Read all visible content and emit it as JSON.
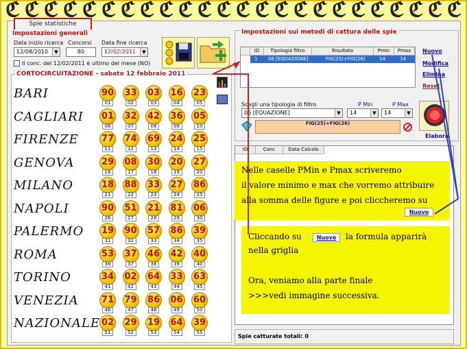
{
  "tab_label": "Spie statistiche",
  "general": {
    "title": "Impostazioni generali",
    "start_label": "Data inizio ricerca",
    "start_value": "12/08/2010",
    "draws_label": "Concorsi",
    "draws_value": "80",
    "end_label": "Data fine ricerca",
    "end_value": "12/02/2011",
    "checkbox_label": "Il conc. del 12/02/2011 è ultimo del mese (NO)"
  },
  "lottery": {
    "title": "CORTOCIRCUITAZIONE - sabato 12 febbraio 2011",
    "rows": [
      {
        "city": "BARI",
        "balls": [
          "90",
          "33",
          "03",
          "16",
          "23"
        ],
        "idx": [
          "01",
          "02",
          "03",
          "04",
          "05"
        ]
      },
      {
        "city": "CAGLIARI",
        "balls": [
          "01",
          "32",
          "42",
          "36",
          "05"
        ],
        "idx": [
          "06",
          "07",
          "08",
          "09",
          "10"
        ]
      },
      {
        "city": "FIRENZE",
        "balls": [
          "77",
          "74",
          "69",
          "24",
          "25"
        ],
        "idx": [
          "11",
          "12",
          "13",
          "14",
          "15"
        ]
      },
      {
        "city": "GENOVA",
        "balls": [
          "29",
          "08",
          "30",
          "20",
          "27"
        ],
        "idx": [
          "16",
          "17",
          "18",
          "19",
          "20"
        ]
      },
      {
        "city": "MILANO",
        "balls": [
          "18",
          "88",
          "33",
          "27",
          "86"
        ],
        "idx": [
          "21",
          "22",
          "23",
          "24",
          "25"
        ]
      },
      {
        "city": "NAPOLI",
        "balls": [
          "90",
          "51",
          "21",
          "81",
          "06"
        ],
        "idx": [
          "26",
          "27",
          "28",
          "29",
          "30"
        ]
      },
      {
        "city": "PALERMO",
        "balls": [
          "19",
          "90",
          "57",
          "86",
          "39"
        ],
        "idx": [
          "31",
          "32",
          "33",
          "34",
          "35"
        ]
      },
      {
        "city": "ROMA",
        "balls": [
          "53",
          "37",
          "46",
          "42",
          "40"
        ],
        "idx": [
          "36",
          "37",
          "38",
          "39",
          "40"
        ]
      },
      {
        "city": "TORINO",
        "balls": [
          "34",
          "02",
          "64",
          "33",
          "63"
        ],
        "idx": [
          "41",
          "42",
          "43",
          "44",
          "45"
        ]
      },
      {
        "city": "VENEZIA",
        "balls": [
          "71",
          "79",
          "86",
          "06",
          "60"
        ],
        "idx": [
          "46",
          "47",
          "48",
          "49",
          "50"
        ]
      },
      {
        "city": "NAZIONALE",
        "balls": [
          "02",
          "29",
          "19",
          "64",
          "39"
        ],
        "idx": [
          "51",
          "52",
          "53",
          "54",
          "55"
        ]
      }
    ]
  },
  "methods": {
    "title": "Impostazioni sui metodi di cattura delle spie",
    "headers": [
      "ID",
      "Tipologia filtro",
      "Risultato",
      "Pmin",
      "Pmax"
    ],
    "row": {
      "id": "1",
      "type": "06 [EQUAZIONE]",
      "result": "FIG(25)+FIG(26)",
      "pmin": "14",
      "pmax": "14"
    },
    "links": {
      "new": "Nuovo",
      "edit": "Modifica",
      "delete": "Elimina",
      "reset": "Reset"
    },
    "filter_label": "Scegli una tipologia di filtro",
    "filter_value": "06 [EQUAZIONE]",
    "pmin_label": "P Min",
    "pmin_value": "14",
    "pmax_label": "P Max",
    "pmax_value": "14",
    "formula": "FIG(25)+FIG(26)",
    "elabora": "Elabora"
  },
  "results": {
    "headers": [
      "ID",
      "Conc",
      "Data Calcolo"
    ],
    "status": "Spie catturate totali: 0"
  },
  "notes": {
    "n1_l1": "Nelle caselle PMin e Pmax scriveremo",
    "n1_l2": "il valore minimo e max che vorremo attribuire",
    "n1_l3": "alla somma delle figure e poi cliccheremo su",
    "n1_btn": "Nuovo",
    "n2_a": "Cliccando su",
    "n2_btn": "Nuovo",
    "n2_b": "la formula apparirà",
    "n2_l2": "nella griglia",
    "n2_l3": "Ora, veniamo alla parte finale",
    "n2_l4": ">>>vedi immagine successiva."
  },
  "colors": {
    "accent_red": "#b01818",
    "note_yellow": "#f5f500",
    "ball_text": "#c01010",
    "selection_blue": "#2d6fd0"
  }
}
